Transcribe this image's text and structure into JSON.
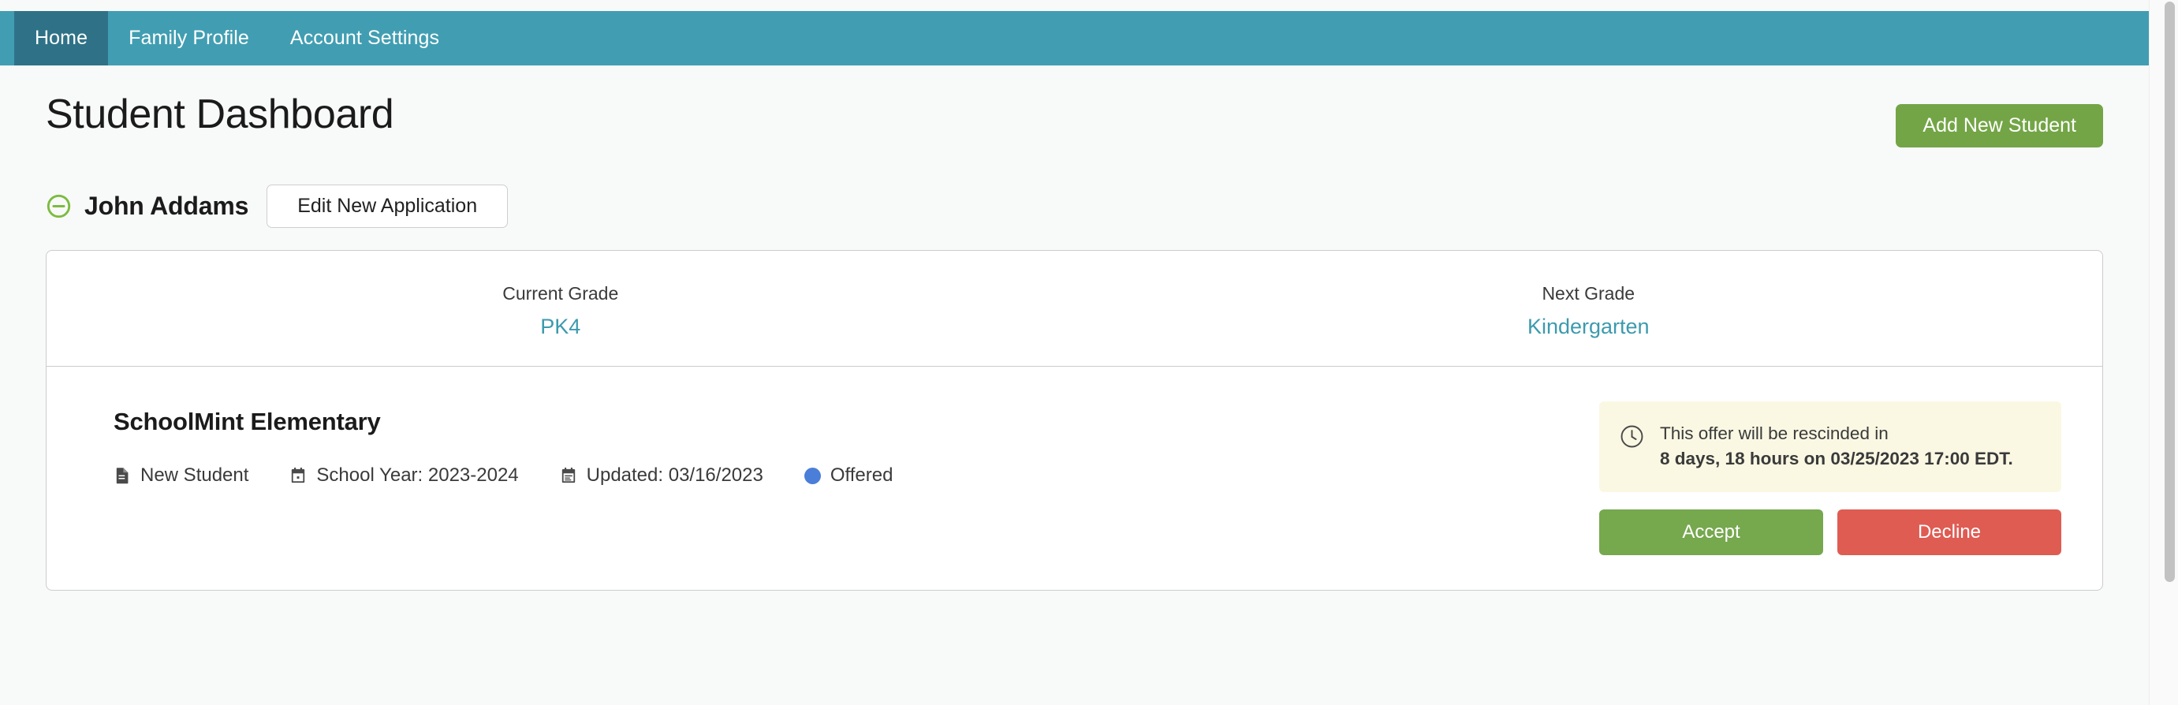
{
  "navbar": {
    "items": [
      {
        "label": "Home",
        "active": true
      },
      {
        "label": "Family Profile",
        "active": false
      },
      {
        "label": "Account Settings",
        "active": false
      }
    ]
  },
  "header": {
    "title": "Student Dashboard",
    "add_student_label": "Add New Student"
  },
  "student": {
    "name": "John Addams",
    "collapse_icon": "circle-minus-icon",
    "edit_application_label": "Edit New Application",
    "grades": [
      {
        "label": "Current Grade",
        "value": "PK4"
      },
      {
        "label": "Next Grade",
        "value": "Kindergarten"
      }
    ],
    "application": {
      "school_name": "SchoolMint Elementary",
      "meta": [
        {
          "icon": "document-icon",
          "label": "New Student"
        },
        {
          "icon": "calendar-icon",
          "label": "School Year: 2023-2024"
        },
        {
          "icon": "calendar-lines-icon",
          "label": "Updated: 03/16/2023"
        },
        {
          "icon": "status-dot-icon",
          "label": "Offered"
        }
      ],
      "status": "Offered",
      "notice": {
        "icon": "clock-icon",
        "lead": "This offer will be rescinded in",
        "detail": "8 days, 18 hours on 03/25/2023 17:00 EDT."
      },
      "accept_label": "Accept",
      "decline_label": "Decline"
    }
  },
  "colors": {
    "navbar": "#419eb2",
    "navbar_active": "#2f7287",
    "accent_teal": "#3d9aae",
    "green": "#73a546",
    "accept_green": "#76a84e",
    "decline_red": "#df5c53",
    "notice_bg": "#faf8e3",
    "status_blue": "#4a7ed8",
    "page_bg": "#f8f9f9",
    "card_border": "#cccccc"
  }
}
